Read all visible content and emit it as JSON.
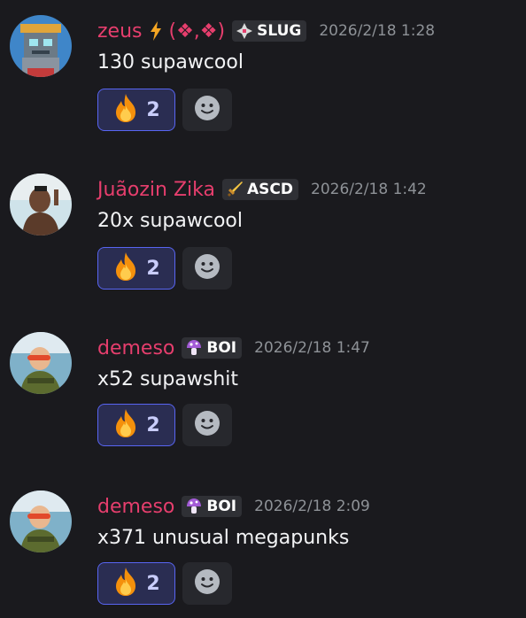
{
  "messages": [
    {
      "username": "zeus",
      "name_extra": "(❖,❖)",
      "tag_label": "SLUG",
      "tag_icon": "diamond-shuriken-icon",
      "timestamp": "2026/2/18 1:28",
      "content": "130 supawcool",
      "reaction_emoji": "fire-icon",
      "reaction_count": "2"
    },
    {
      "username": "Juãozin Zika",
      "tag_label": "ASCD",
      "tag_icon": "sword-icon",
      "timestamp": "2026/2/18 1:42",
      "content": "20x supawcool",
      "reaction_emoji": "fire-icon",
      "reaction_count": "2"
    },
    {
      "username": "demeso",
      "tag_label": "BOI",
      "tag_icon": "mushroom-icon",
      "timestamp": "2026/2/18 1:47",
      "content": "x52 supawshit",
      "reaction_emoji": "fire-icon",
      "reaction_count": "2"
    },
    {
      "username": "demeso",
      "tag_label": "BOI",
      "tag_icon": "mushroom-icon",
      "timestamp": "2026/2/18 2:09",
      "content": "x371 unusual megapunks",
      "reaction_emoji": "fire-icon",
      "reaction_count": "2"
    }
  ],
  "colors": {
    "background": "#1a1a1e",
    "username": "#e63e6d",
    "timestamp": "#8e9297",
    "reaction_border": "#5865f2",
    "reaction_bg": "#2a2d52",
    "add_reaction_bg": "#27282d"
  }
}
